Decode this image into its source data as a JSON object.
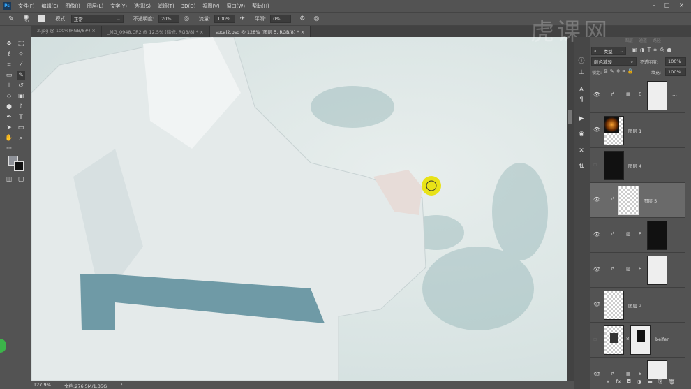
{
  "app": {
    "logo": "Ps"
  },
  "menu": [
    "文件(F)",
    "编辑(E)",
    "图像(I)",
    "图层(L)",
    "文字(Y)",
    "选择(S)",
    "滤镜(T)",
    "3D(D)",
    "视图(V)",
    "窗口(W)",
    "帮助(H)"
  ],
  "window_controls": {
    "minimize": "–",
    "maximize": "□",
    "close": "×"
  },
  "options": {
    "brush_size": "30",
    "mode_label": "模式:",
    "mode_value": "正常",
    "opacity_label": "不透明度:",
    "opacity_value": "20%",
    "flow_label": "流量:",
    "flow_value": "100%",
    "smoothing_label": "平滑:",
    "smoothing_value": "0%"
  },
  "tabs": [
    {
      "label": "2.jpg @ 100%(RGB/8#)",
      "close": "×"
    },
    {
      "label": "_MG_0948.CR2 @ 12.5% (精修, RGB/8) *",
      "close": "×"
    },
    {
      "label": "sucai2.psd @ 128% (图层 5, RGB/8) *",
      "close": "×"
    }
  ],
  "watermark": "虎课网",
  "layers_panel": {
    "tabs": [
      "图层",
      "通道",
      "路径"
    ],
    "filter_label": "类型",
    "blend_mode": "颜色减淡",
    "opacity_label": "不透明度:",
    "opacity_value": "100%",
    "lock_label": "锁定:",
    "fill_label": "填充:",
    "fill_value": "100%",
    "layers": [
      {
        "name": "",
        "visible": true
      },
      {
        "name": "图层 1",
        "visible": true
      },
      {
        "name": "图层 4",
        "visible": false
      },
      {
        "name": "图层 5",
        "visible": true,
        "selected": true
      },
      {
        "name": "",
        "visible": true
      },
      {
        "name": "",
        "visible": true
      },
      {
        "name": "图层 2",
        "visible": true
      },
      {
        "name": "beifen",
        "visible": false
      },
      {
        "name": "",
        "visible": true
      }
    ]
  },
  "status": {
    "zoom": "127.9%",
    "doc": "文档:276.5M/1.35G"
  },
  "colors": {
    "accent": "#31a8ff",
    "cursor": "#e8e000",
    "belt": "#6f9aa6"
  }
}
